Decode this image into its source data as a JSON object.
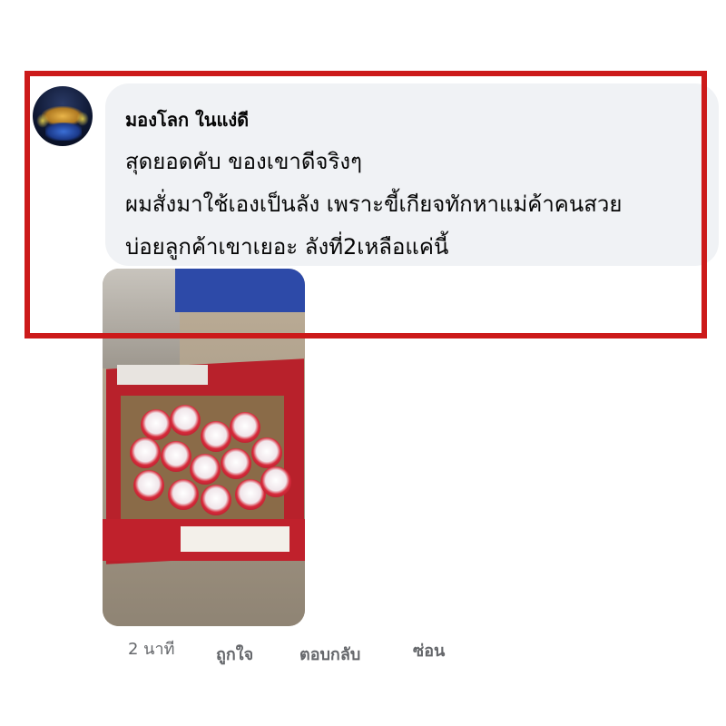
{
  "comment": {
    "author": "มองโลก ในแง่ดี",
    "lines": [
      "สุดยอดคับ ของเขาดีจริงๆ",
      "ผมสั่งมาใช้เองเป็นลัง เพราะขี้เกียจทักหาแม่ค้าคนสวย",
      "บ่อยลูกค้าเขาเยอะ ลังที่2เหลือแค่นี้"
    ]
  },
  "actions": {
    "time": "2 นาที",
    "like": "ถูกใจ",
    "reply": "ตอบกลับ",
    "hide": "ซ่อน"
  },
  "colors": {
    "highlight_border": "#cc1a1a",
    "bubble_bg": "#f0f2f5",
    "secondary_text": "#65676b"
  }
}
